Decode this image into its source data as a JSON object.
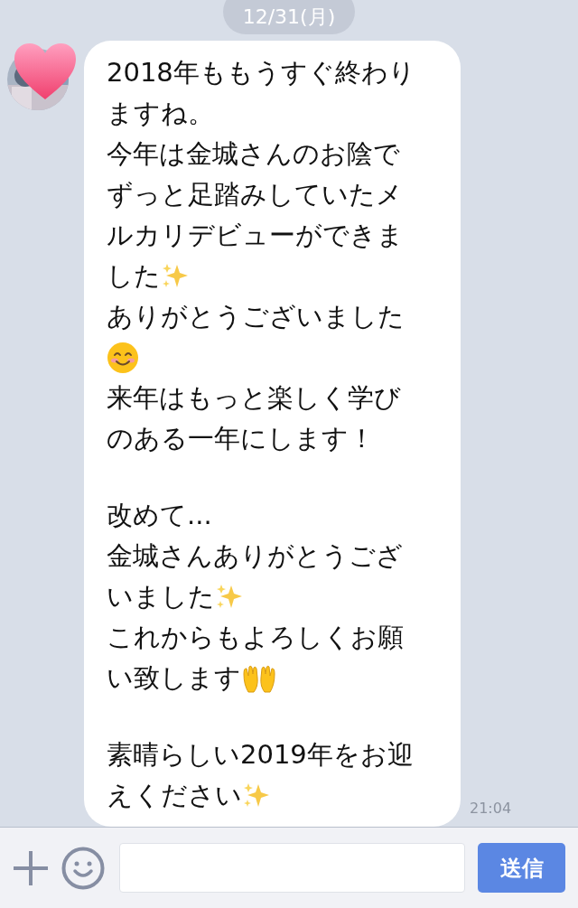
{
  "date_label": "12/31(月)",
  "message": {
    "lines": [
      {
        "kind": "text",
        "parts": [
          {
            "kind": "text",
            "text": "2018年ももうすぐ終わり"
          }
        ]
      },
      {
        "kind": "text",
        "parts": [
          {
            "kind": "text",
            "text": "ますね。"
          }
        ]
      },
      {
        "kind": "text",
        "parts": [
          {
            "kind": "text",
            "text": "今年は金城さんのお陰で"
          }
        ]
      },
      {
        "kind": "text",
        "parts": [
          {
            "kind": "text",
            "text": "ずっと足踏みしていたメ"
          }
        ]
      },
      {
        "kind": "text",
        "parts": [
          {
            "kind": "text",
            "text": "ルカリデビューができま"
          }
        ]
      },
      {
        "kind": "text",
        "parts": [
          {
            "kind": "text",
            "text": "した"
          },
          {
            "kind": "sparkles"
          }
        ]
      },
      {
        "kind": "text",
        "parts": [
          {
            "kind": "text",
            "text": "ありがとうございました"
          }
        ]
      },
      {
        "kind": "text",
        "parts": [
          {
            "kind": "smile"
          }
        ]
      },
      {
        "kind": "text",
        "parts": [
          {
            "kind": "text",
            "text": "来年はもっと楽しく学び"
          }
        ]
      },
      {
        "kind": "text",
        "parts": [
          {
            "kind": "text",
            "text": "のある一年にします！"
          }
        ]
      },
      {
        "kind": "blank"
      },
      {
        "kind": "text",
        "parts": [
          {
            "kind": "text",
            "text": "改めて..."
          }
        ]
      },
      {
        "kind": "text",
        "parts": [
          {
            "kind": "text",
            "text": "金城さんありがとうござ"
          }
        ]
      },
      {
        "kind": "text",
        "parts": [
          {
            "kind": "text",
            "text": "いました"
          },
          {
            "kind": "sparkles"
          }
        ]
      },
      {
        "kind": "text",
        "parts": [
          {
            "kind": "text",
            "text": "これからもよろしくお願"
          }
        ]
      },
      {
        "kind": "text",
        "parts": [
          {
            "kind": "text",
            "text": "い致します"
          },
          {
            "kind": "hands"
          }
        ]
      },
      {
        "kind": "blank"
      },
      {
        "kind": "text",
        "parts": [
          {
            "kind": "text",
            "text": "素晴らしい2019年をお迎"
          }
        ]
      },
      {
        "kind": "text",
        "parts": [
          {
            "kind": "text",
            "text": "えください"
          },
          {
            "kind": "sparkles"
          }
        ]
      }
    ],
    "time": "21:04"
  },
  "input_bar": {
    "send_button": "送信"
  }
}
